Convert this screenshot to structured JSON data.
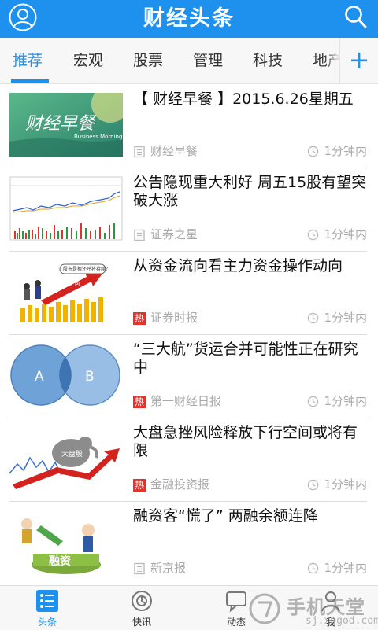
{
  "header": {
    "title": "财经头条"
  },
  "tabs": [
    {
      "label": "推荐"
    },
    {
      "label": "宏观"
    },
    {
      "label": "股票"
    },
    {
      "label": "管理"
    },
    {
      "label": "科技"
    },
    {
      "label": "地产"
    }
  ],
  "add_label": "+",
  "articles": [
    {
      "title": "【 财经早餐 】2015.6.26星期五",
      "source": "财经早餐",
      "hot": false,
      "time": "1分钟内",
      "thumb_text": "财经早餐",
      "thumb_sub": "Business Morning"
    },
    {
      "title": "公告隐现重大利好 周五15股有望突破大涨",
      "source": "证券之星",
      "hot": false,
      "time": "1分钟内"
    },
    {
      "title": "从资金流向看主力资金操作动向",
      "source": "证券时报",
      "hot": true,
      "time": "1分钟内",
      "thumb_text": "股市是换还呼将持续？"
    },
    {
      "title": "“三大航”货运合并可能性正在研究中",
      "source": "第一财经日报",
      "hot": true,
      "time": "1分钟内",
      "thumb_a": "A",
      "thumb_b": "B"
    },
    {
      "title": "大盘急挫风险释放下行空间或将有限",
      "source": "金融投资报",
      "hot": true,
      "time": "1分钟内",
      "thumb_text": "大盘股"
    },
    {
      "title": "融资客“慌了” 两融余额连降",
      "source": "新京报",
      "hot": false,
      "time": "1分钟内",
      "thumb_text": "融资"
    }
  ],
  "hot_label": "热",
  "bottom_nav": [
    {
      "label": "头条",
      "icon": "list-icon",
      "active": true
    },
    {
      "label": "快讯",
      "icon": "clock-icon",
      "active": false
    },
    {
      "label": "动态",
      "icon": "chat-icon",
      "active": false
    },
    {
      "label": "我",
      "icon": "person-icon",
      "active": false
    }
  ],
  "watermark": {
    "text": "手机天堂",
    "url": "sj.xpgod.com"
  },
  "colors": {
    "primary": "#1e90ee",
    "hot": "#e8312b",
    "text": "#111111",
    "meta": "#aaaaaa"
  }
}
